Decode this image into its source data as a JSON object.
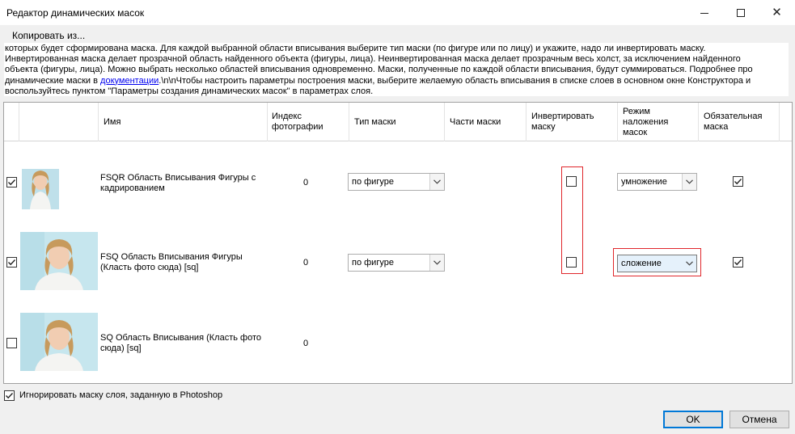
{
  "window": {
    "title": "Редактор динамических масок",
    "menu_copy": "Копировать из..."
  },
  "description": {
    "line1": "которых будет сформирована маска. Для каждой выбранной области вписывания выберите тип маски (по фигуре или по лицу) и укажите, надо ли инвертировать маску.",
    "line2": "Инвертированная маска делает прозрачной область найденного объекта (фигуры, лица). Неинвертированная маска делает прозрачным весь холст, за исключением найденного",
    "line3": "объекта (фигуры, лица). Можно выбрать несколько областей вписывания одновременно. Маски, полученные по каждой области вписывания, будут суммироваться. Подробнее про",
    "line4_before": "динамические маски в ",
    "line4_link": "документации",
    "line4_after": ".\\n\\nЧтобы настроить параметры построения маски, выберите желаемую область вписывания в списке слоев в основном окне Конструктора и",
    "line5": "воспользуйтесь пунктом \"Параметры создания динамических масок\" в параметрах слоя."
  },
  "columns": {
    "name": "Имя",
    "photo_index": "Индекс фотографии",
    "mask_type": "Тип маски",
    "mask_parts": "Части маски",
    "invert": "Инвертировать маску",
    "blend_mode": "Режим наложения масок",
    "required": "Обязательная маска"
  },
  "rows": [
    {
      "checked": true,
      "name": "FSQR Область Вписывания Фигуры с кадрированием",
      "index": "0",
      "mask_type": "по фигуре",
      "invert": false,
      "blend": "умножение",
      "required": true
    },
    {
      "checked": true,
      "name": "FSQ Область Вписывания Фигуры (Класть фото сюда) [sq]",
      "index": "0",
      "mask_type": "по фигуре",
      "invert": false,
      "blend": "сложение",
      "required": true
    },
    {
      "checked": false,
      "name": "SQ Область Вписывания (Класть фото сюда) [sq]",
      "index": "0"
    }
  ],
  "footer": {
    "ignore_layer_mask": "Игнорировать маску слоя, заданную в Photoshop",
    "ok": "OK",
    "cancel": "Отмена"
  },
  "colors": {
    "highlight": "#e0262b",
    "accent": "#0078d7"
  }
}
